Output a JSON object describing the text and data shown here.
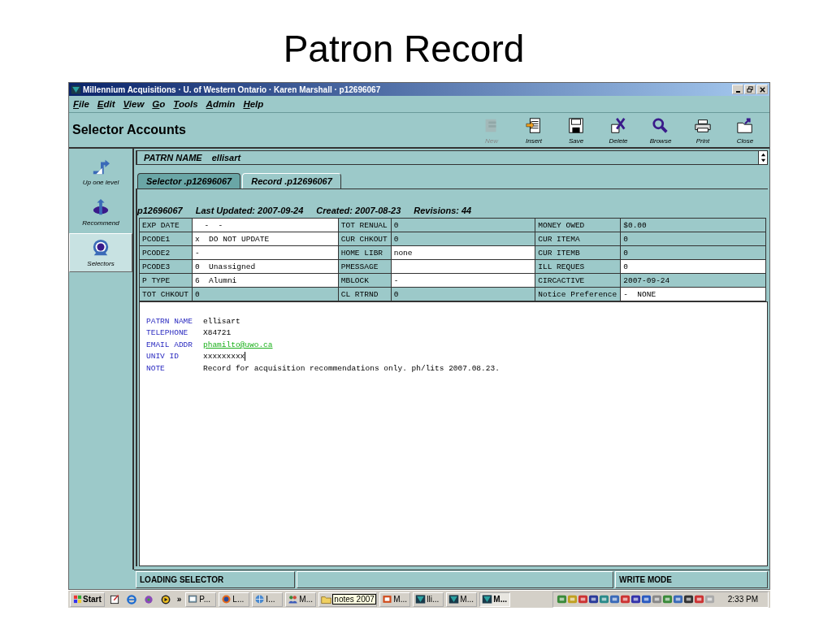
{
  "slide_title": "Patron Record",
  "window": {
    "title": "Millennium Acquisitions · U. of Western Ontario · Karen Marshall · p12696067"
  },
  "menu": [
    "File",
    "Edit",
    "View",
    "Go",
    "Tools",
    "Admin",
    "Help"
  ],
  "toolbar": {
    "title": "Selector Accounts",
    "buttons": [
      {
        "label": "New",
        "kind": "new",
        "disabled": true
      },
      {
        "label": "Insert",
        "kind": "insert",
        "disabled": false
      },
      {
        "label": "Save",
        "kind": "save",
        "disabled": false
      },
      {
        "label": "Delete",
        "kind": "delete",
        "disabled": false
      },
      {
        "label": "Browse",
        "kind": "search",
        "disabled": false
      },
      {
        "label": "Print",
        "kind": "print",
        "disabled": false
      },
      {
        "label": "Close",
        "kind": "close",
        "disabled": false
      }
    ]
  },
  "sidebar": {
    "items": [
      {
        "label": "Up one level",
        "kind": "up",
        "selected": false
      },
      {
        "label": "Recommend",
        "kind": "recommend",
        "selected": false
      },
      {
        "label": "Selectors",
        "kind": "selectors",
        "selected": true
      }
    ]
  },
  "patron_bar": {
    "label": "PATRN NAME",
    "value": "ellisart"
  },
  "tabs": [
    {
      "label": "Selector .p12696067",
      "selected": false
    },
    {
      "label": "Record .p12696067",
      "selected": true
    }
  ],
  "record_header": [
    "p12696067",
    "Last Updated: 2007-09-24",
    "Created: 2007-08-23",
    "Revisions: 44"
  ],
  "fixed_fields": [
    [
      {
        "label": "EXP DATE",
        "value": "  -  -",
        "editable": true
      },
      {
        "label": "TOT RENUAL",
        "value": "0",
        "editable": false
      },
      {
        "label": "MONEY OWED",
        "value": "$0.00",
        "editable": false
      }
    ],
    [
      {
        "label": "PCODE1",
        "value": "x  DO NOT UPDATE",
        "editable": true
      },
      {
        "label": "CUR CHKOUT",
        "value": "0",
        "editable": false
      },
      {
        "label": "CUR ITEMA",
        "value": "0",
        "editable": false
      }
    ],
    [
      {
        "label": "PCODE2",
        "value": "-",
        "editable": true
      },
      {
        "label": "HOME LIBR",
        "value": "none",
        "editable": true
      },
      {
        "label": "CUR ITEMB",
        "value": "0",
        "editable": false
      }
    ],
    [
      {
        "label": "PCODE3",
        "value": "0  Unassigned",
        "editable": true
      },
      {
        "label": "PMESSAGE",
        "editable": true
      },
      {
        "label": "ILL REQUES",
        "value": "0",
        "editable": true
      }
    ],
    [
      {
        "label": "P TYPE",
        "value": "6  Alumni",
        "editable": true
      },
      {
        "label": "MBLOCK",
        "value": "-",
        "editable": true
      },
      {
        "label": "CIRCACTIVE",
        "value": "2007-09-24",
        "editable": false
      }
    ],
    [
      {
        "label": "TOT CHKOUT",
        "value": "0",
        "editable": false
      },
      {
        "label": "CL RTRND",
        "value": "0",
        "editable": false
      },
      {
        "label": "Notice Preference",
        "value": "-  NONE",
        "editable": true
      }
    ]
  ],
  "variable_fields": [
    {
      "label": "PATRN NAME",
      "value": "ellisart",
      "kind": "text",
      "focused": false
    },
    {
      "label": "TELEPHONE",
      "value": "X84721",
      "kind": "text",
      "focused": false
    },
    {
      "label": "EMAIL ADDR",
      "value": "phamilto@uwo.ca",
      "kind": "link",
      "focused": false
    },
    {
      "label": "UNIV ID",
      "value": "xxxxxxxxx",
      "kind": "text",
      "focused": true
    },
    {
      "label": "NOTE",
      "value": "Record for acquisition recommendations only. ph/lits 2007.08.23.",
      "kind": "text",
      "focused": false
    }
  ],
  "status_bar": {
    "left": "LOADING SELECTOR",
    "right": "WRITE MODE"
  },
  "taskbar": {
    "start": "Start",
    "more": "»",
    "tasks": [
      {
        "label": "P...",
        "kind": "app",
        "selected": false
      },
      {
        "label": "L...",
        "kind": "fox",
        "selected": false
      },
      {
        "label": "I...",
        "kind": "globe",
        "selected": false
      },
      {
        "label": "M...",
        "kind": "people",
        "selected": false
      },
      {
        "kind": "folder",
        "selected": false
      },
      {
        "label": "M...",
        "kind": "slides",
        "selected": false
      },
      {
        "label": "lli...",
        "kind": "millennium",
        "selected": false
      },
      {
        "label": "M...",
        "kind": "millennium",
        "selected": false
      },
      {
        "label": "M...",
        "kind": "millennium",
        "selected": true
      }
    ],
    "tooltip": "notes 2007",
    "clock": "2:33 PM"
  }
}
